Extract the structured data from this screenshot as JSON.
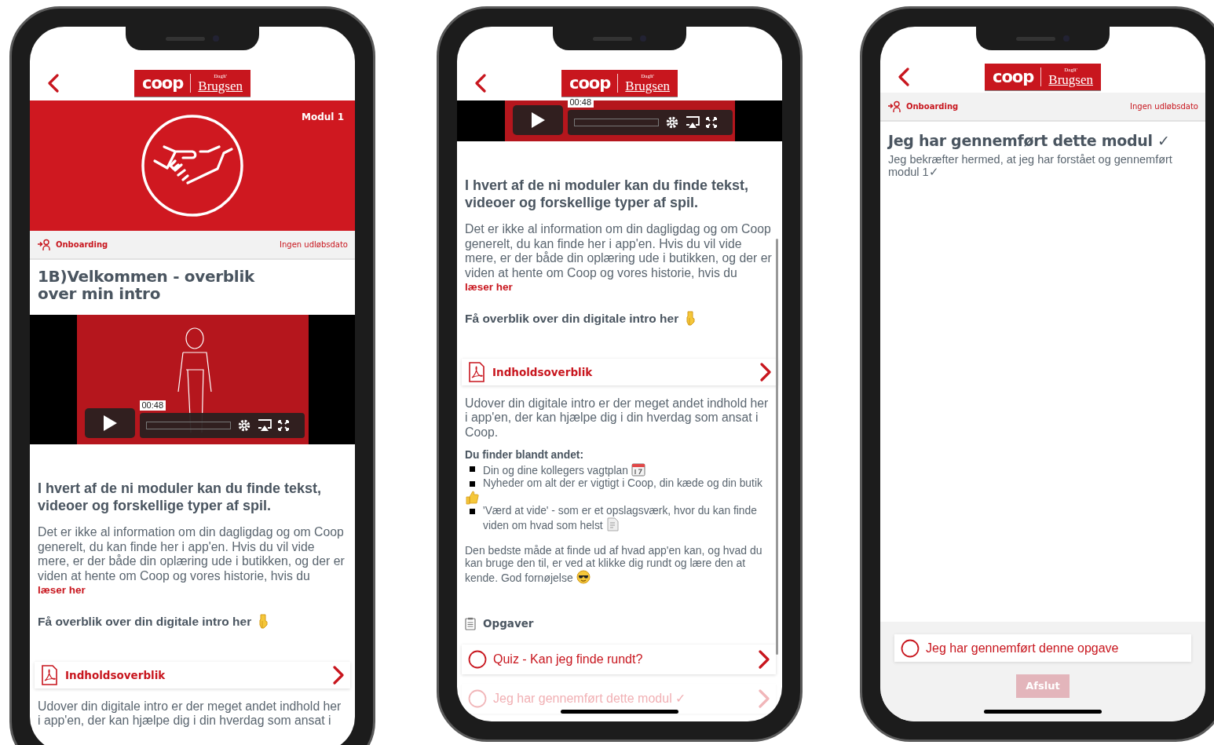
{
  "phones": [
    {
      "logo": {
        "brand": "coop",
        "tag": "Dagli'",
        "name": "Brugsen"
      },
      "blocks": [
        {
          "kind": "hero",
          "badge": "Modul 1"
        },
        {
          "kind": "meta",
          "category": "Onboarding",
          "expiry": "Ingen udløbsdato"
        },
        {
          "kind": "title",
          "text": "1B)Velkommen - overblik over min intro"
        },
        {
          "kind": "video",
          "time": "00:48"
        },
        {
          "kind": "heading",
          "text": "I hvert af de ni moduler kan du finde tekst, videoer og forskellige typer af spil."
        },
        {
          "kind": "paragraph",
          "text": "Det er ikke al information om din dagligdag og om Coop generelt, du kan finde her i app'en. Hvis du vil vide mere, er der både din oplæring ude i butikken, og der er viden at hente om Coop og vores historie, hvis du",
          "link": "læser her"
        },
        {
          "kind": "lead",
          "text": "Få overblik over din digitale intro her"
        },
        {
          "kind": "pdf_link",
          "label": "Indholdsoverblik"
        },
        {
          "kind": "paragraph",
          "text": "Udover din digitale intro er der meget andet indhold her i app'en, der kan hjælpe dig i din hverdag som ansat i"
        }
      ]
    },
    {
      "logo": {
        "brand": "coop",
        "tag": "Dagli'",
        "name": "Brugsen"
      },
      "blocks": [
        {
          "kind": "video_strip",
          "time": "00:48"
        },
        {
          "kind": "heading",
          "text": "I hvert af de ni moduler kan du finde tekst, videoer og forskellige typer af spil."
        },
        {
          "kind": "paragraph",
          "text": "Det er ikke al information om din dagligdag og om Coop generelt, du kan finde her i app'en. Hvis du vil vide mere, er der både din oplæring ude i butikken, og der er viden at hente om Coop og vores historie, hvis du",
          "link": "læser her"
        },
        {
          "kind": "lead",
          "text": "Få overblik over din digitale intro her"
        },
        {
          "kind": "pdf_link",
          "label": "Indholdsoverblik"
        },
        {
          "kind": "paragraph",
          "text": "Udover din digitale intro er der meget andet indhold her i app'en, der kan hjælpe dig i din hverdag som ansat i Coop."
        },
        {
          "kind": "list",
          "title": "Du finder blandt andet:",
          "items": [
            "Din og dine kollegers vagtplan",
            "Nyheder om alt der er vigtigt i Coop, din kæde og din butik",
            "'Værd at vide' - som er et opslagsværk, hvor du kan finde viden om hvad som helst"
          ]
        },
        {
          "kind": "small_paragraph",
          "text": "Den bedste måde at finde ud af hvad app'en kan, og hvad du kan bruge den til, er ved at klikke dig rundt og lære den at kende. God fornøjelse"
        },
        {
          "kind": "section",
          "label": "Opgaver"
        },
        {
          "kind": "task",
          "label": "Quiz - Kan jeg finde rundt?",
          "disabled": false
        },
        {
          "kind": "task",
          "label": "Jeg har gennemført dette modul ✓",
          "disabled": true
        }
      ]
    },
    {
      "logo": {
        "brand": "coop",
        "tag": "Dagli'",
        "name": "Brugsen"
      },
      "blocks": [
        {
          "kind": "meta",
          "category": "Onboarding",
          "expiry": "Ingen udløbsdato"
        },
        {
          "kind": "title2",
          "text": "Jeg har gennemført dette modul ✓"
        },
        {
          "kind": "note",
          "text": "Jeg bekræfter hermed, at jeg har forstået og gennemført modul 1✓"
        }
      ],
      "footer": {
        "option": {
          "label": "Jeg har gennemført denne opgave",
          "checked": false
        },
        "button": {
          "label": "Afslut",
          "disabled": true
        }
      }
    }
  ]
}
